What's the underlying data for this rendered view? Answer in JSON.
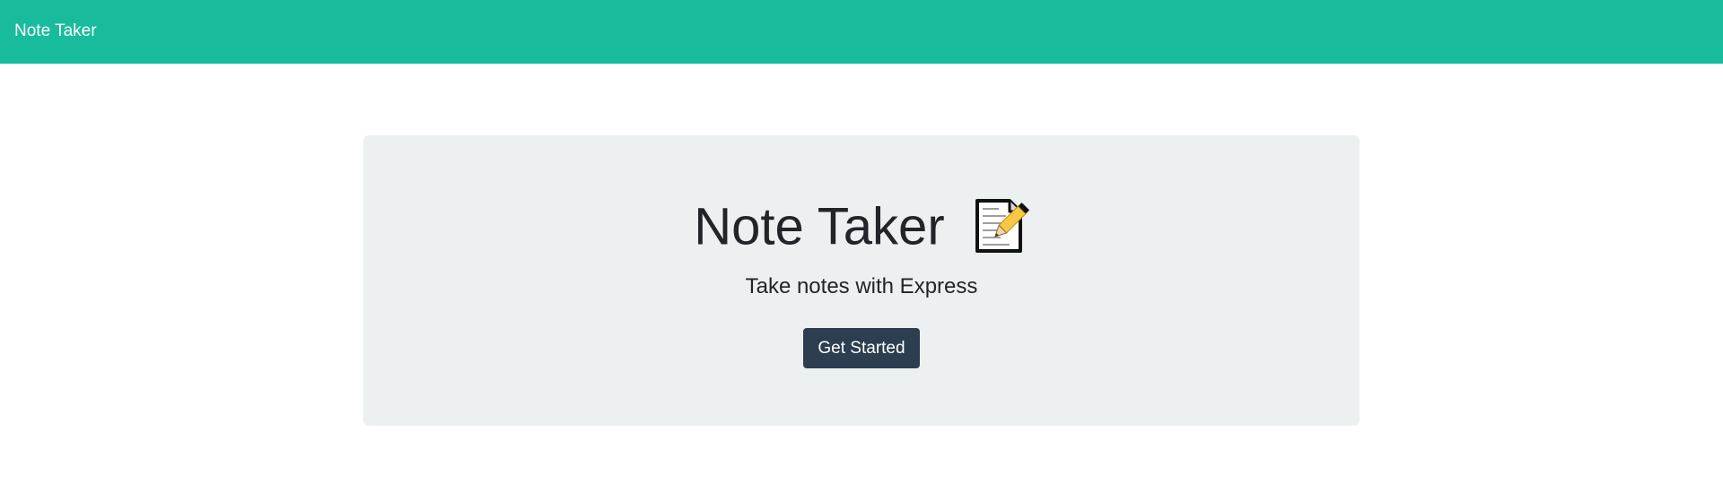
{
  "navbar": {
    "brand": "Note Taker",
    "color": "#18bc9c"
  },
  "hero": {
    "title": "Note Taker",
    "icon": "memo-icon",
    "subtitle": "Take notes with Express",
    "button_label": "Get Started",
    "panel_color": "#ecf0f1",
    "button_color": "#2c3e50"
  }
}
